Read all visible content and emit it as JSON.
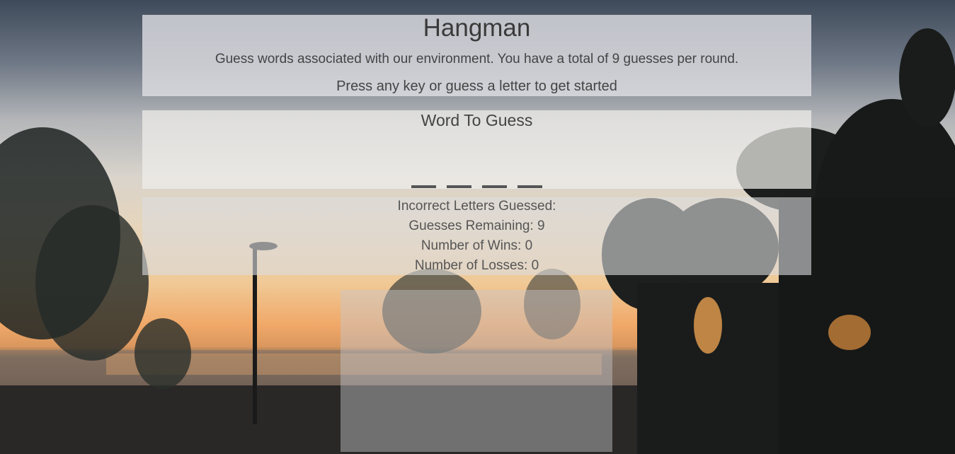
{
  "header": {
    "title": "Hangman",
    "subtitle": "Guess words associated with our environment. You have a total of 9 guesses per round.",
    "prompt": "Press any key or guess a letter to get started"
  },
  "word": {
    "title": "Word To Guess",
    "blank_count": 4
  },
  "stats": {
    "incorrect": "Incorrect Letters Guessed:",
    "remaining": "Guesses Remaining: 9",
    "wins": "Number of Wins: 0",
    "losses": "Number of Losses: 0"
  },
  "colors": {
    "panel": "#e1e1e6",
    "text": "#444444"
  }
}
